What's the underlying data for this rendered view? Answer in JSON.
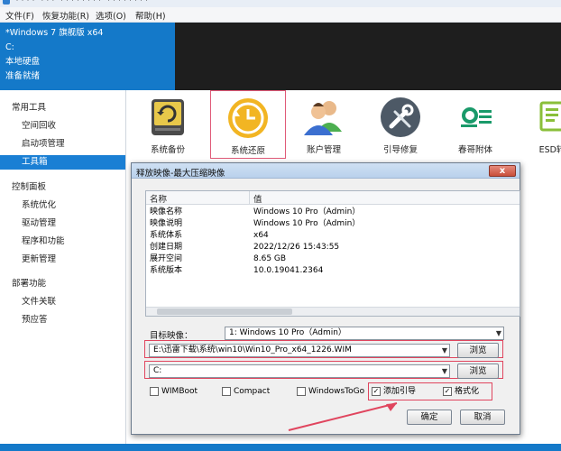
{
  "window": {
    "title": "**** *** ******** ********"
  },
  "menu": [
    {
      "id": "file",
      "label": "文件(F)"
    },
    {
      "id": "restore",
      "label": "恢复功能(R)"
    },
    {
      "id": "options",
      "label": "选项(O)"
    },
    {
      "id": "help",
      "label": "帮助(H)"
    }
  ],
  "system_info": {
    "os": "*Windows 7 旗舰版 x64",
    "drive": "C:",
    "disk": "本地硬盘",
    "status": "准备就绪"
  },
  "sidebar": {
    "groups": [
      {
        "title": "常用工具",
        "items": [
          "空间回收",
          "启动项管理",
          "工具箱"
        ]
      },
      {
        "title": "控制面板",
        "items": [
          "系统优化",
          "驱动管理",
          "程序和功能",
          "更新管理"
        ]
      },
      {
        "title": "部署功能",
        "items": [
          "文件关联",
          "预应答"
        ]
      }
    ],
    "active_item": "工具箱"
  },
  "toolbar": {
    "tools": [
      {
        "label": "系统备份",
        "icon": "backup-icon"
      },
      {
        "label": "系统还原",
        "icon": "restore-clock-icon"
      },
      {
        "label": "账户管理",
        "icon": "users-icon"
      },
      {
        "label": "引导修复",
        "icon": "wrench-screwdriver-icon"
      },
      {
        "label": "春哥附体",
        "icon": "chart-list-icon"
      },
      {
        "label": "ESD转",
        "icon": "document-icon"
      }
    ],
    "selected": "系统还原"
  },
  "dialog": {
    "title": "释放映像-最大压缩映像",
    "close_label": "x",
    "columns": [
      "名称",
      "值"
    ],
    "properties": [
      {
        "name": "映像名称",
        "value": "Windows 10 Pro（Admin）"
      },
      {
        "name": "映像说明",
        "value": "Windows 10 Pro（Admin）"
      },
      {
        "name": "系统体系",
        "value": "x64"
      },
      {
        "name": "创建日期",
        "value": "2022/12/26 15:43:55"
      },
      {
        "name": "展开空间",
        "value": "8.65 GB"
      },
      {
        "name": "系统版本",
        "value": "10.0.19041.2364"
      }
    ],
    "target_label": "目标映像：",
    "target_value": "1: Windows 10 Pro（Admin）",
    "source_path": "E:\\迅雷下载\\系统\\win10\\Win10_Pro_x64_1226.WIM",
    "dest_path": "C:",
    "browse_label": "浏览",
    "checkboxes": [
      {
        "label": "WIMBoot",
        "checked": false
      },
      {
        "label": "Compact",
        "checked": false
      },
      {
        "label": "WindowsToGo",
        "checked": false
      },
      {
        "label": "添加引导",
        "checked": true
      },
      {
        "label": "格式化",
        "checked": true
      }
    ],
    "ok_label": "确定",
    "cancel_label": "取消"
  },
  "colors": {
    "accent_blue": "#1479c9",
    "highlight_red": "#e0455e"
  }
}
